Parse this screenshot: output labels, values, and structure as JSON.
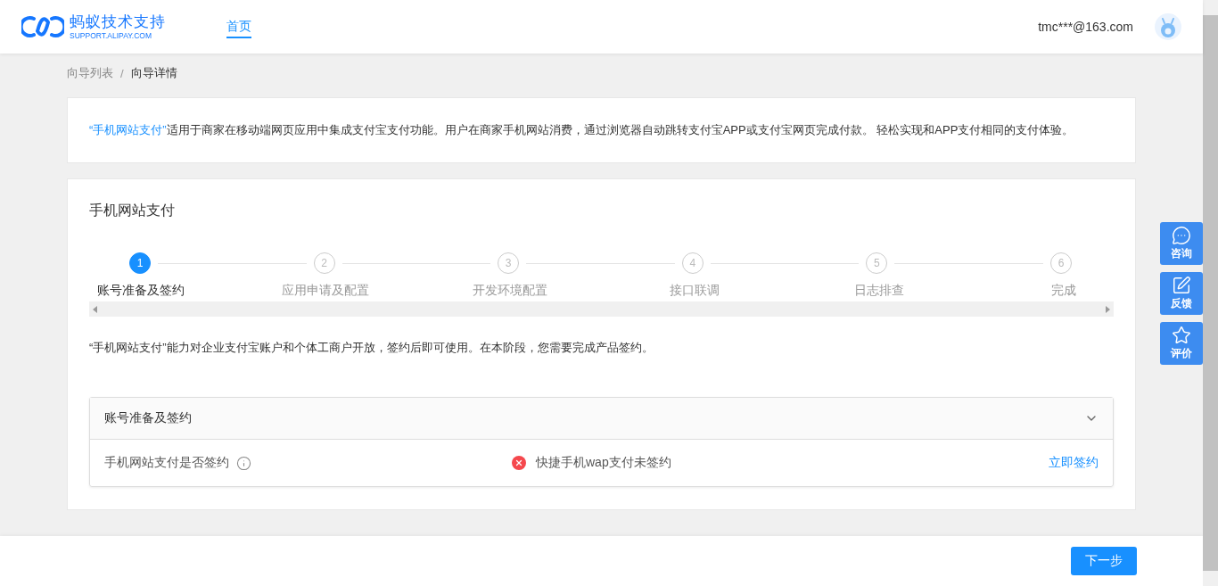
{
  "header": {
    "logo": {
      "title": "蚂蚁技术支持",
      "subtitle": "SUPPORT.ALIPAY.COM"
    },
    "nav": [
      {
        "label": "首页",
        "selected": true
      }
    ],
    "user_email": "tmc***@163.com"
  },
  "breadcrumb": [
    {
      "label": "向导列表",
      "selected": false
    },
    {
      "label": "向导详情",
      "selected": true
    }
  ],
  "breadcrumb_separator": "/",
  "intro": {
    "product": "“手机网站支付”",
    "text": "适用于商家在移动端网页应用中集成支付宝支付功能。用户在商家手机网站消费，通过浏览器自动跳转支付宝APP或支付宝网页完成付款。 轻松实现和APP支付相同的支付体验。"
  },
  "guide": {
    "title": "手机网站支付",
    "steps": [
      {
        "number": "1",
        "label": "账号准备及签约",
        "selected": true
      },
      {
        "number": "2",
        "label": "应用申请及配置",
        "selected": false
      },
      {
        "number": "3",
        "label": "开发环境配置",
        "selected": false
      },
      {
        "number": "4",
        "label": "接口联调",
        "selected": false
      },
      {
        "number": "5",
        "label": "日志排查",
        "selected": false
      },
      {
        "number": "6",
        "label": "完成",
        "selected": false
      }
    ],
    "description": "“手机网站支付”能力对企业支付宝账户和个体工商户开放，签约后即可使用。在本阶段，您需要完成产品签约。",
    "panel": {
      "title": "账号准备及签约",
      "expanded": true,
      "rows": [
        {
          "label": "手机网站支付是否签约",
          "signed": false,
          "status_text": "快捷手机wap支付未签约",
          "action": "立即签约"
        }
      ]
    }
  },
  "side_buttons": [
    {
      "kind": "chat",
      "label": "咨询"
    },
    {
      "kind": "edit",
      "label": "反馈"
    },
    {
      "kind": "star",
      "label": "评价"
    }
  ],
  "footer": {
    "next_button": "下一步"
  }
}
